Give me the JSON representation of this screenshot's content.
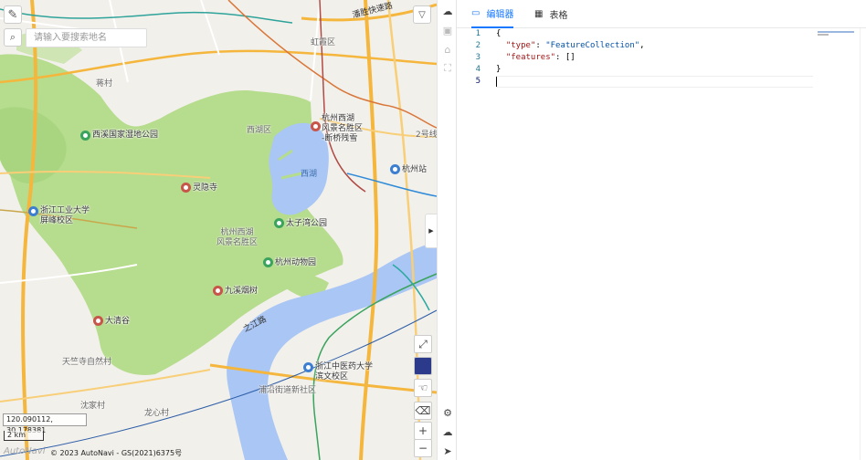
{
  "map": {
    "search": {
      "placeholder": "请输入要搜索地名"
    },
    "coordinates": "120.090112, 30.178381",
    "scale": "2 km",
    "copyright": "© 2023 AutoNavi - GS(2021)6375号",
    "logo": "AutoNavi",
    "water_labels": [
      "西湖"
    ],
    "road_labels": [
      "之江路",
      "潘胜快速路"
    ],
    "pois": [
      {
        "name": "杭州西湖风景名胜区-断桥残雪",
        "lines": [
          "杭州西湖",
          "风景名胜区",
          "-断桥残雪"
        ],
        "type": "red"
      },
      {
        "name": "西溪国家湿地公园",
        "lines": [
          "西溪国家湿地公园"
        ],
        "type": "green"
      },
      {
        "name": "杭州站",
        "lines": [
          "杭州站"
        ],
        "type": "blue"
      },
      {
        "name": "灵隐寺",
        "lines": [
          "灵隐寺"
        ],
        "type": "red"
      },
      {
        "name": "浙江工业大学屏峰校区",
        "lines": [
          "浙江工业大学",
          "屏峰校区"
        ],
        "type": "blue"
      },
      {
        "name": "太子湾公园",
        "lines": [
          "太子湾公园"
        ],
        "type": "green"
      },
      {
        "name": "杭州动物园",
        "lines": [
          "杭州动物园"
        ],
        "type": "green"
      },
      {
        "name": "九溪烟树",
        "lines": [
          "九溪烟树"
        ],
        "type": "red"
      },
      {
        "name": "大清谷",
        "lines": [
          "大清谷"
        ],
        "type": "red"
      },
      {
        "name": "浙江中医药大学滨文校区",
        "lines": [
          "浙江中医药大学",
          "滨文校区"
        ],
        "type": "blue"
      }
    ],
    "area_labels": [
      {
        "text": "虹霞区"
      },
      {
        "text": "西湖区"
      },
      {
        "text": "蒋村"
      },
      {
        "text": "杭州西湖\n风景名胜区"
      },
      {
        "text": "天竺寺自然村"
      },
      {
        "text": "沈家村"
      },
      {
        "text": "龙心村"
      },
      {
        "text": "浦沿街道新社区"
      },
      {
        "text": "2号线"
      }
    ]
  },
  "editor": {
    "tabs": [
      {
        "label": "编辑器",
        "active": true
      },
      {
        "label": "表格",
        "active": false
      }
    ],
    "line_numbers": [
      "1",
      "2",
      "3",
      "4",
      "5"
    ],
    "code_lines": [
      "{",
      "  \"type\": \"FeatureCollection\",",
      "  \"features\": []",
      "}",
      ""
    ]
  },
  "icons": {
    "draw": "pencil-icon",
    "search": "search-icon",
    "filter": "filter-icon",
    "upload": "cloud-upload-icon",
    "save": "save-icon",
    "home": "home-icon",
    "crop": "crop-icon",
    "settings": "gear-icon",
    "download": "cloud-download-icon",
    "pointer": "cursor-icon",
    "fullscreen": "fullscreen-icon",
    "layer": "layer-icon",
    "hand": "hand-icon",
    "clear": "eraser-icon",
    "zoom_in": "plus-icon",
    "zoom_out": "minus-icon"
  },
  "colors": {
    "accent": "#1677ff",
    "park": "#b5dc8c",
    "water": "#a9c6f4",
    "road_major": "#f5b63d"
  }
}
